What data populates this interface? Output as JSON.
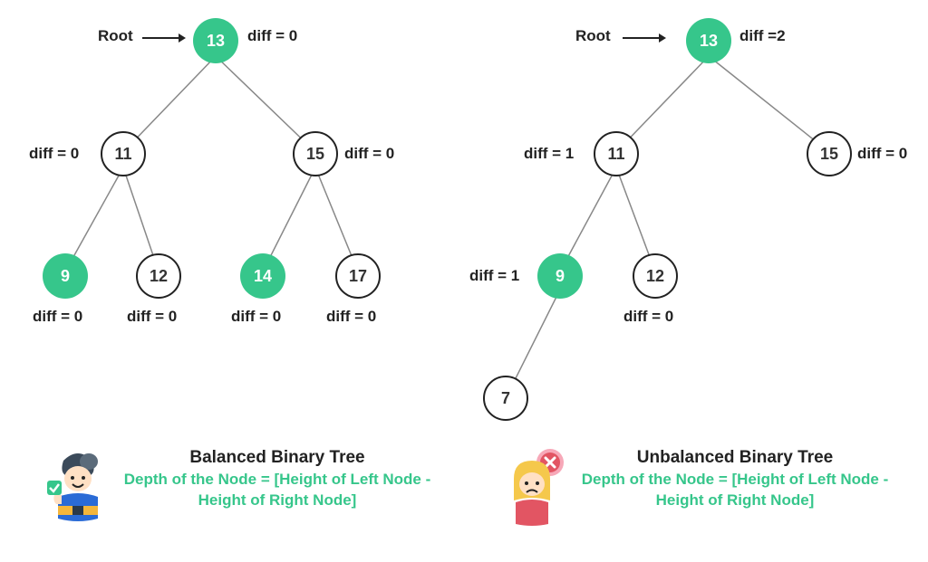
{
  "left_tree": {
    "root_label": "Root",
    "nodes": {
      "n13": {
        "value": "13",
        "diff": "diff  = 0"
      },
      "n11": {
        "value": "11",
        "diff": "diff  = 0"
      },
      "n15": {
        "value": "15",
        "diff": "diff  = 0"
      },
      "n9": {
        "value": "9",
        "diff": "diff  = 0"
      },
      "n12": {
        "value": "12",
        "diff": "diff  = 0"
      },
      "n14": {
        "value": "14",
        "diff": "diff  = 0"
      },
      "n17": {
        "value": "17",
        "diff": "diff  = 0"
      }
    },
    "caption_title": "Balanced Binary Tree",
    "caption_sub": "Depth of the Node = [Height of Left Node - Height of Right Node]"
  },
  "right_tree": {
    "root_label": "Root",
    "nodes": {
      "n13": {
        "value": "13",
        "diff": "diff  =2"
      },
      "n11": {
        "value": "11",
        "diff": "diff  = 1"
      },
      "n15": {
        "value": "15",
        "diff": "diff  = 0"
      },
      "n9": {
        "value": "9",
        "diff": "diff  = 1"
      },
      "n12": {
        "value": "12",
        "diff": "diff  = 0"
      },
      "n7": {
        "value": "7"
      }
    },
    "caption_title": "Unbalanced Binary Tree",
    "caption_sub": "Depth of the Node = [Height of Left Node - Height of Right Node]"
  }
}
